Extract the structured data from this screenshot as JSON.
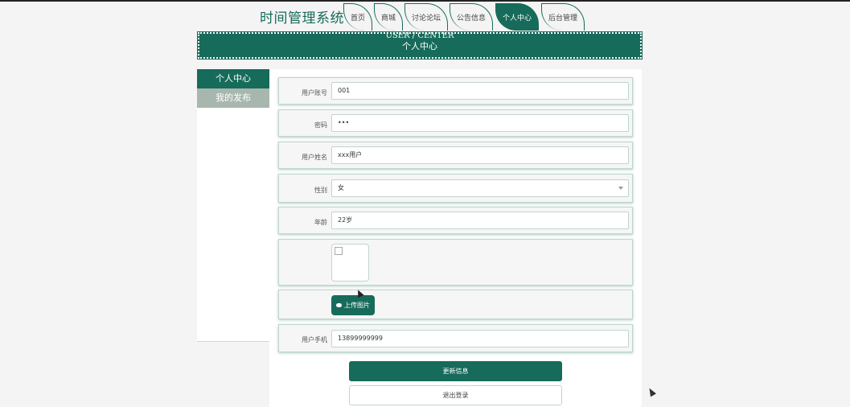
{
  "site": {
    "title": "时间管理系统"
  },
  "nav": {
    "tabs": [
      {
        "label": "首页"
      },
      {
        "label": "商城"
      },
      {
        "label": "讨论论坛"
      },
      {
        "label": "公告信息"
      },
      {
        "label": "个人中心"
      },
      {
        "label": "后台管理"
      }
    ],
    "active_index": 4
  },
  "banner": {
    "en": "USER / CENTER",
    "cn": "个人中心"
  },
  "sidebar": {
    "items": [
      {
        "label": "个人中心"
      },
      {
        "label": "我的发布"
      }
    ]
  },
  "form": {
    "account": {
      "label": "用户账号",
      "value": "001"
    },
    "password": {
      "label": "密码",
      "value": "•••"
    },
    "name": {
      "label": "用户姓名",
      "value": "xxx用户"
    },
    "gender": {
      "label": "性别",
      "value": "女"
    },
    "age": {
      "label": "年龄",
      "value": "22岁"
    },
    "upload_label": "上传图片",
    "phone": {
      "label": "用户手机",
      "value": "13899999999"
    }
  },
  "buttons": {
    "update": "更新信息",
    "logout": "退出登录"
  },
  "colors": {
    "accent": "#176b5b",
    "sidebar_inactive": "#a8b7ae"
  }
}
